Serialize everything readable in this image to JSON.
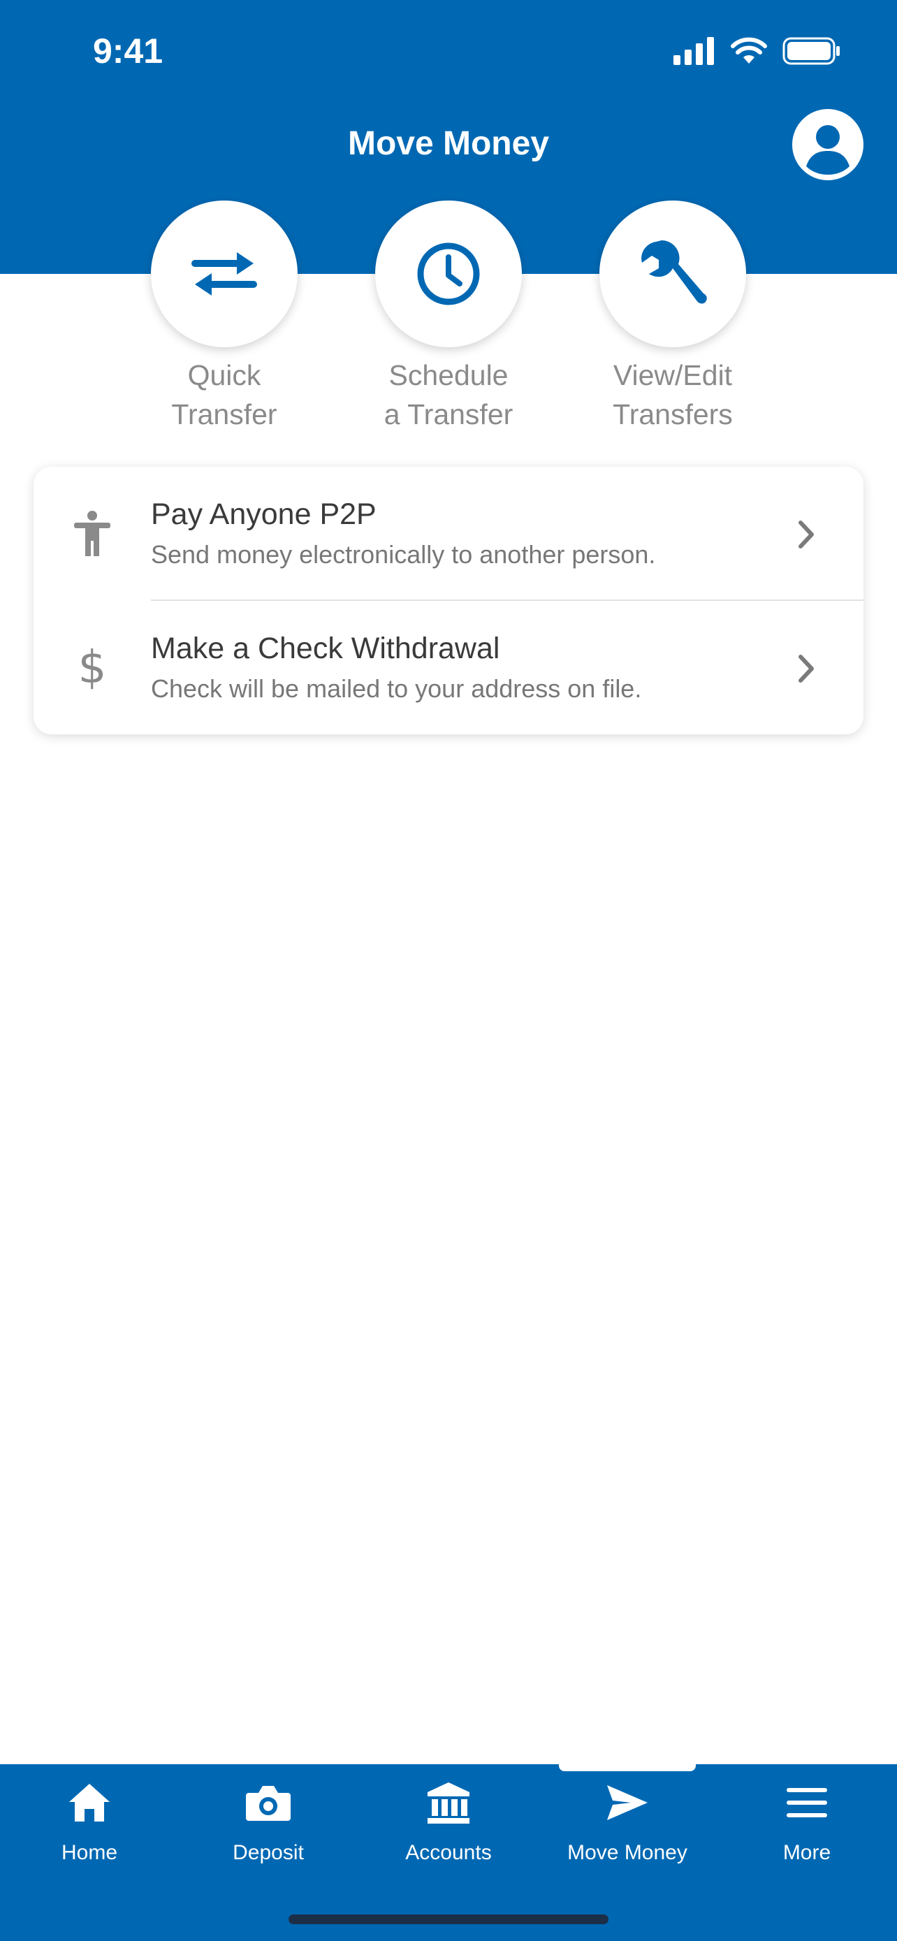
{
  "status": {
    "time": "9:41"
  },
  "header": {
    "title": "Move Money"
  },
  "actions": [
    {
      "line1": "Quick",
      "line2": "Transfer",
      "icon": "transfer-arrows-icon"
    },
    {
      "line1": "Schedule",
      "line2": "a Transfer",
      "icon": "clock-icon"
    },
    {
      "line1": "View/Edit",
      "line2": "Transfers",
      "icon": "wrench-icon"
    }
  ],
  "list": [
    {
      "title": "Pay Anyone P2P",
      "subtitle": "Send money electronically to another person.",
      "icon": "person-icon"
    },
    {
      "title": "Make a Check Withdrawal",
      "subtitle": "Check will be mailed to your address on file.",
      "icon": "dollar-icon"
    }
  ],
  "tabs": [
    {
      "label": "Home",
      "icon": "home-icon"
    },
    {
      "label": "Deposit",
      "icon": "camera-icon"
    },
    {
      "label": "Accounts",
      "icon": "bank-icon"
    },
    {
      "label": "Move Money",
      "icon": "send-icon",
      "active": true
    },
    {
      "label": "More",
      "icon": "menu-icon"
    }
  ],
  "colors": {
    "brand": "#0068B3",
    "icon_gray": "#8a8a8a"
  }
}
